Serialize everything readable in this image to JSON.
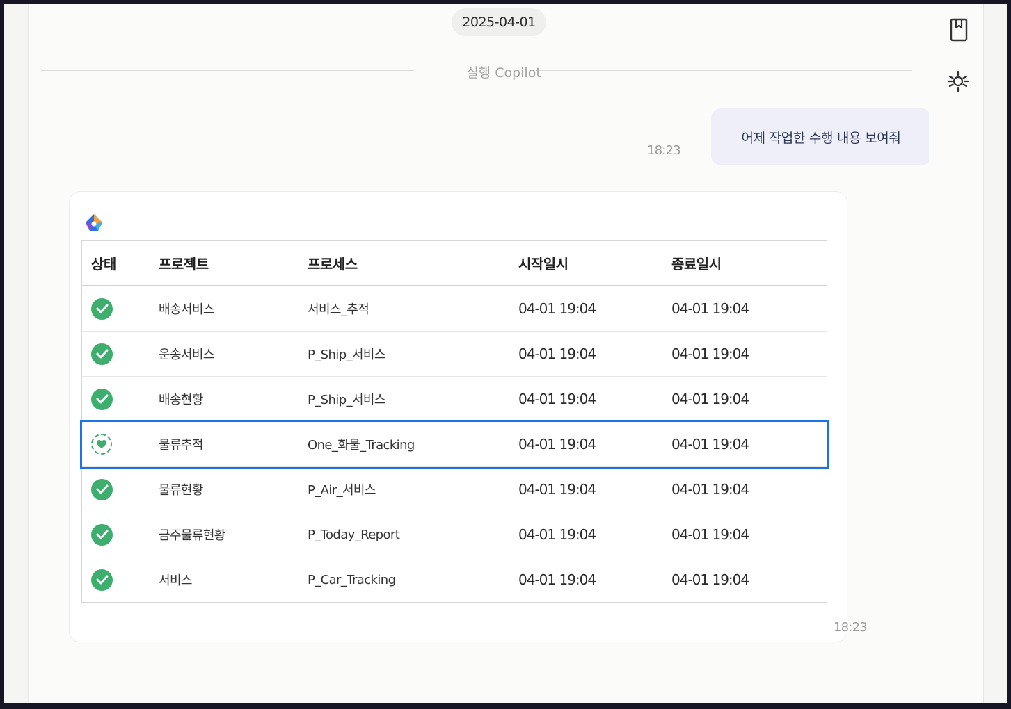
{
  "date_pill": "2025-04-01",
  "divider_label": "실행 Copilot",
  "user_message": {
    "text": "어제 작업한 수행 내용 보여줘",
    "time": "18:23"
  },
  "bot_message": {
    "time": "18:23",
    "table": {
      "headers": [
        "상태",
        "프로젝트",
        "프로세스",
        "시작일시",
        "종료일시"
      ],
      "rows": [
        {
          "status": "success-icon",
          "project": "배송서비스",
          "process": "서비스_추적",
          "start": "04-01 19:04",
          "end": "04-01 19:04"
        },
        {
          "status": "success-icon",
          "project": "운송서비스",
          "process": "P_Ship_서비스",
          "start": "04-01 19:04",
          "end": "04-01 19:04"
        },
        {
          "status": "success-icon",
          "project": "배송현황",
          "process": "P_Ship_서비스",
          "start": "04-01 19:04",
          "end": "04-01 19:04"
        },
        {
          "status": "running-icon",
          "project": "물류추적",
          "process": "One_화물_Tracking",
          "start": "04-01 19:04",
          "end": "04-01 19:04"
        },
        {
          "status": "success-icon",
          "project": "물류현황",
          "process": "P_Air_서비스",
          "start": "04-01 19:04",
          "end": "04-01 19:04"
        },
        {
          "status": "success-icon",
          "project": "금주물류현황",
          "process": "P_Today_Report",
          "start": "04-01 19:04",
          "end": "04-01 19:04"
        },
        {
          "status": "success-icon",
          "project": "서비스",
          "process": "P_Car_Tracking",
          "start": "04-01 19:04",
          "end": "04-01 19:04"
        }
      ]
    }
  },
  "side_rail": {
    "icons": [
      "bookmark-icon",
      "settings-sliders-icon"
    ]
  },
  "colors": {
    "success": "#3dae6e",
    "highlight": "#1a73e8",
    "user_bubble": "#eeeff9"
  }
}
